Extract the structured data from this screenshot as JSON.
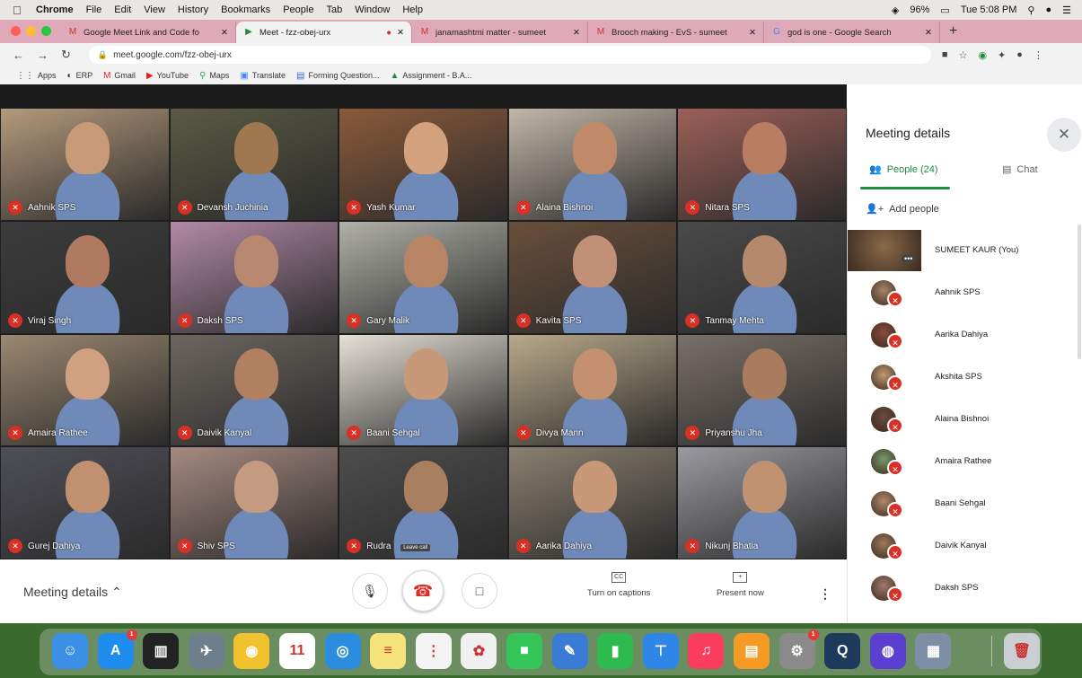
{
  "menubar": {
    "app": "Chrome",
    "items": [
      "File",
      "Edit",
      "View",
      "History",
      "Bookmarks",
      "People",
      "Tab",
      "Window",
      "Help"
    ],
    "battery": "96%",
    "clock": "Tue 5:08 PM"
  },
  "tabs": [
    {
      "title": "Google Meet Link and Code fo",
      "favicon": "gmail-icon",
      "active": false
    },
    {
      "title": "Meet - fzz-obej-urx",
      "favicon": "meet-icon",
      "active": true
    },
    {
      "title": "janamashtmi matter - sumeet",
      "favicon": "gmail-icon",
      "active": false
    },
    {
      "title": "Brooch making - EvS - sumeet",
      "favicon": "gmail-icon",
      "active": false
    },
    {
      "title": "god is one - Google Search",
      "favicon": "google-icon",
      "active": false
    }
  ],
  "address": {
    "url": "meet.google.com/fzz-obej-urx"
  },
  "bookmarks": [
    {
      "label": "Apps",
      "icon": "apps-icon"
    },
    {
      "label": "ERP",
      "icon": "erp-icon"
    },
    {
      "label": "Gmail",
      "icon": "gmail-icon"
    },
    {
      "label": "YouTube",
      "icon": "youtube-icon"
    },
    {
      "label": "Maps",
      "icon": "maps-icon"
    },
    {
      "label": "Translate",
      "icon": "translate-icon"
    },
    {
      "label": "Forming Question...",
      "icon": "forms-icon"
    },
    {
      "label": "Assignment - B.A...",
      "icon": "drive-icon"
    }
  ],
  "participants": [
    {
      "name": "Aahnik SPS",
      "bg": "#b59a7c",
      "skin": "#c99a78"
    },
    {
      "name": "Devansh Juchinia",
      "bg": "#5a5a44",
      "skin": "#a07850"
    },
    {
      "name": "Yash Kumar",
      "bg": "#8a5a3a",
      "skin": "#d3a27d"
    },
    {
      "name": "Alaina Bishnoi",
      "bg": "#c2b6a8",
      "skin": "#c08a68"
    },
    {
      "name": "Nitara SPS",
      "bg": "#9d6058",
      "skin": "#b97e62"
    },
    {
      "name": "Viraj Singh",
      "bg": "#3c3c3c",
      "skin": "#b07a60"
    },
    {
      "name": "Daksh SPS",
      "bg": "#b38aa6",
      "skin": "#b98870"
    },
    {
      "name": "Gary Malik",
      "bg": "#b1b1a9",
      "skin": "#b88466"
    },
    {
      "name": "Kavita SPS",
      "bg": "#6a4f3a",
      "skin": "#c29076"
    },
    {
      "name": "Tanmay Mehta",
      "bg": "#4a4a4a",
      "skin": "#b58a6c"
    },
    {
      "name": "Amaira Rathee",
      "bg": "#9b8870",
      "skin": "#d0a080"
    },
    {
      "name": "Daivik Kanyal",
      "bg": "#6c6660",
      "skin": "#b08060"
    },
    {
      "name": "Baani Sehgal",
      "bg": "#e6e1d7",
      "skin": "#c89878"
    },
    {
      "name": "Divya Mann",
      "bg": "#b9a98a",
      "skin": "#c49070"
    },
    {
      "name": "Priyanshu Jha",
      "bg": "#7a7068",
      "skin": "#aa7c5e"
    },
    {
      "name": "Gurej Dahiya",
      "bg": "#4f4f58",
      "skin": "#c09070"
    },
    {
      "name": "Shiv SPS",
      "bg": "#a68a82",
      "skin": "#c49a80"
    },
    {
      "name": "Rudra",
      "bg": "#4d4d4d",
      "skin": "#a88060"
    },
    {
      "name": "Aarika Dahiya",
      "bg": "#8a8070",
      "skin": "#c89878"
    },
    {
      "name": "Nikunj Bhatia",
      "bg": "#9a9aa0",
      "skin": "#c09272"
    }
  ],
  "leave_call_tooltip": "Leave call",
  "bottom": {
    "meeting_details": "Meeting details",
    "captions_label": "Turn on captions",
    "captions_glyph": "CC",
    "present_label": "Present now"
  },
  "panel": {
    "title": "Meeting details",
    "people_tab": "People (24)",
    "chat_tab": "Chat",
    "add_people": "Add people",
    "people": [
      {
        "name": "SUMEET KAUR (You)",
        "color": "#8a6a4a"
      },
      {
        "name": "Aahnik SPS",
        "color": "#a88466"
      },
      {
        "name": "Aarika Dahiya",
        "color": "#8a4a3a"
      },
      {
        "name": "Akshita SPS",
        "color": "#c49a72"
      },
      {
        "name": "Alaina Bishnoi",
        "color": "#6a4a3a"
      },
      {
        "name": "Amaira Rathee",
        "color": "#7a9a6a"
      },
      {
        "name": "Baani Sehgal",
        "color": "#b08a6a"
      },
      {
        "name": "Daivik Kanyal",
        "color": "#9a7a5a"
      },
      {
        "name": "Daksh SPS",
        "color": "#a07a6a"
      }
    ]
  },
  "dock": [
    {
      "name": "finder",
      "color": "#3b8fe6",
      "glyph": "☺"
    },
    {
      "name": "app-store",
      "color": "#1f8cf0",
      "glyph": "A",
      "badge": "1"
    },
    {
      "name": "piano-app",
      "color": "#222222",
      "glyph": "▥"
    },
    {
      "name": "launchpad",
      "color": "#6f7e8c",
      "glyph": "✈"
    },
    {
      "name": "chrome",
      "color": "#f2c12e",
      "glyph": "◉"
    },
    {
      "name": "calendar",
      "color": "#ffffff",
      "glyph": "11"
    },
    {
      "name": "safari",
      "color": "#2a8de0",
      "glyph": "◎"
    },
    {
      "name": "notes",
      "color": "#f6e27a",
      "glyph": "≡"
    },
    {
      "name": "reminders",
      "color": "#f4f4f4",
      "glyph": "⋮"
    },
    {
      "name": "photos",
      "color": "#f0f0f0",
      "glyph": "✿"
    },
    {
      "name": "facetime",
      "color": "#35c659",
      "glyph": "■"
    },
    {
      "name": "preview",
      "color": "#3a7bd5",
      "glyph": "✎"
    },
    {
      "name": "numbers",
      "color": "#2dbb4f",
      "glyph": "▮"
    },
    {
      "name": "keynote",
      "color": "#2f86e6",
      "glyph": "⊤"
    },
    {
      "name": "music",
      "color": "#fa3d5e",
      "glyph": "♫"
    },
    {
      "name": "books",
      "color": "#f59a23",
      "glyph": "▤"
    },
    {
      "name": "system-preferences",
      "color": "#8a8a8a",
      "glyph": "⚙",
      "badge": "1"
    },
    {
      "name": "quicktime",
      "color": "#1d3a5c",
      "glyph": "Q"
    },
    {
      "name": "siri",
      "color": "#5b3fd1",
      "glyph": "◍"
    },
    {
      "name": "image-capture",
      "color": "#7c8fa6",
      "glyph": "▦"
    },
    {
      "name": "trash",
      "color": "#c9cfd2",
      "glyph": "🗑"
    }
  ]
}
